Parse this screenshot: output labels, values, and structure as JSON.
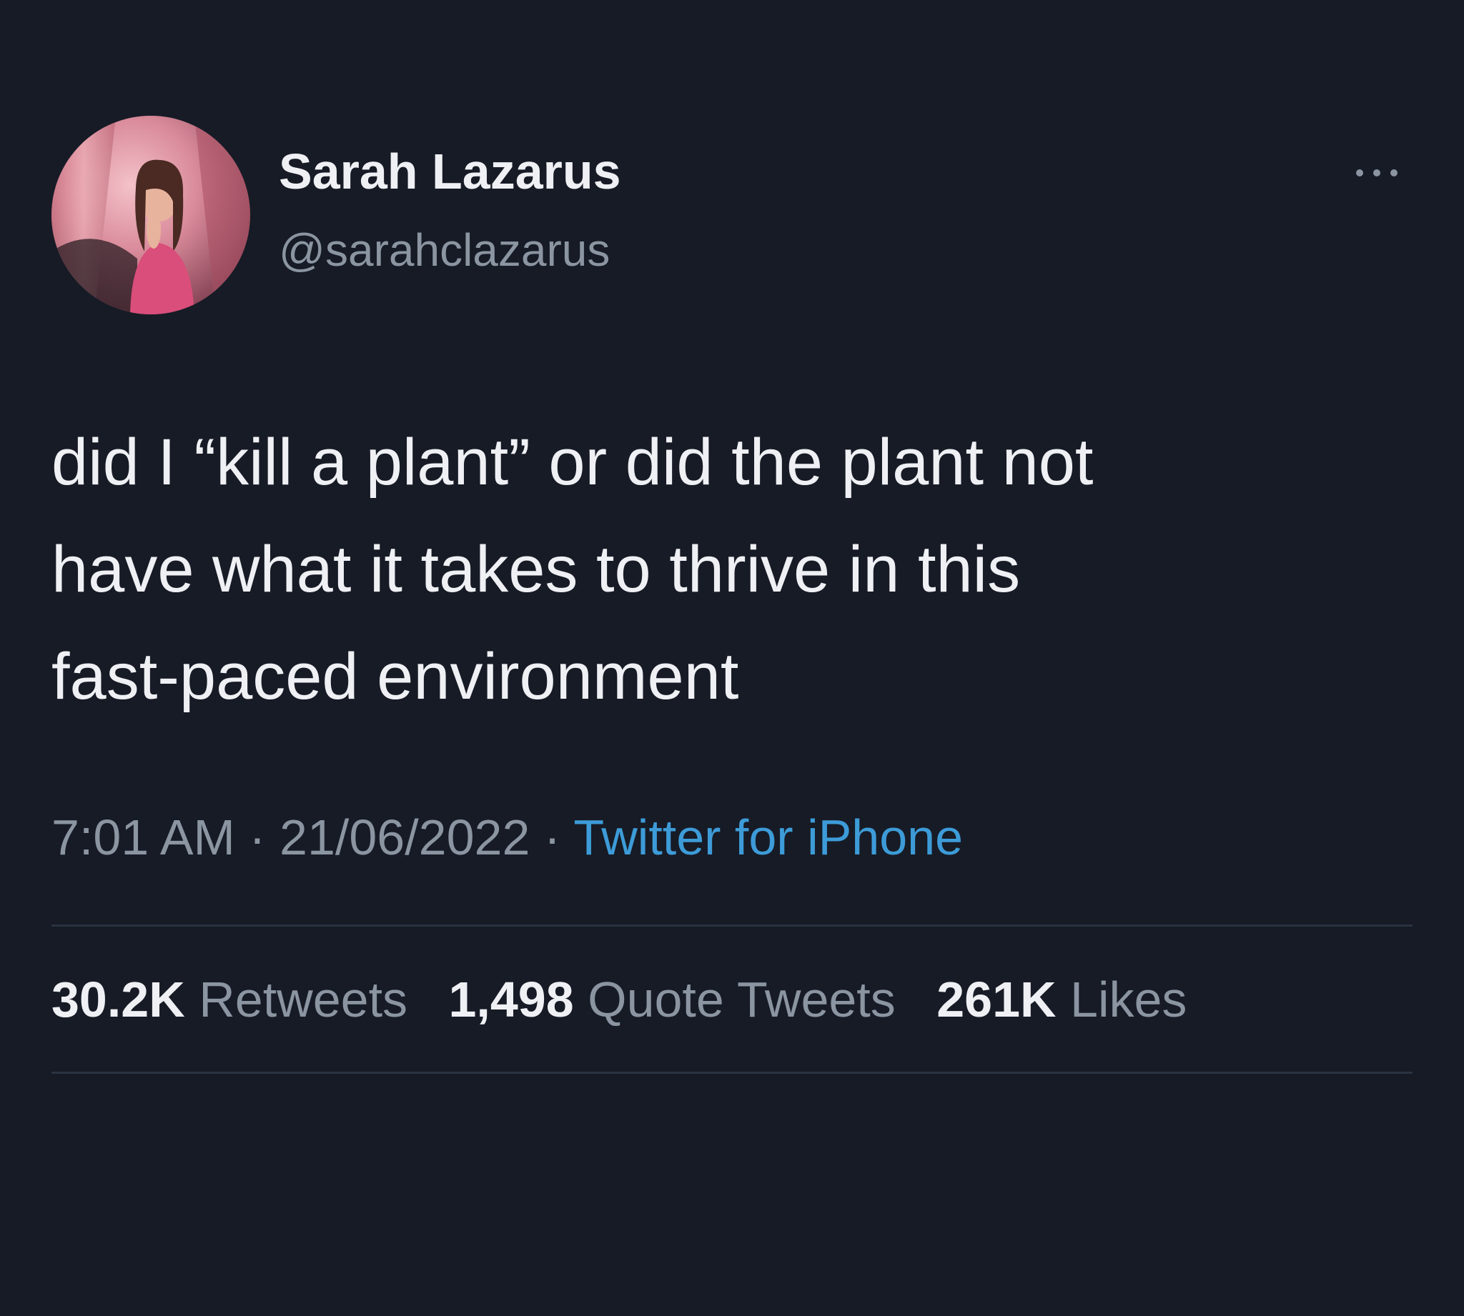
{
  "author": {
    "display_name": "Sarah Lazarus",
    "handle": "@sarahclazarus",
    "avatar_icon": "profile-photo"
  },
  "more_icon": "more-dots-icon",
  "tweet": {
    "lines": [
      "did I “kill a plant” or did the plant not",
      "have what it takes to thrive in this",
      "fast-paced environment"
    ]
  },
  "meta": {
    "time": "7:01 AM",
    "separator": "·",
    "date": "21/06/2022",
    "source": "Twitter for iPhone"
  },
  "stats": [
    {
      "count": "30.2K",
      "label": "Retweets"
    },
    {
      "count": "1,498",
      "label": "Quote Tweets"
    },
    {
      "count": "261K",
      "label": "Likes"
    }
  ],
  "colors": {
    "background": "#161b25",
    "primary_text": "#eef0f3",
    "secondary_text": "#8b95a2",
    "link": "#3d9bd8",
    "divider": "#2c3340"
  }
}
